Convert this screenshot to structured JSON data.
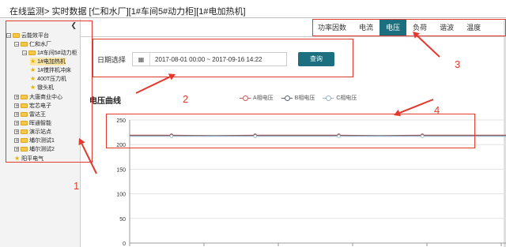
{
  "breadcrumb": "在线监测> 实时数据 [仁和水厂][1#车间5#动力柜][1#电加热机]",
  "sidebar": {
    "collapse_glyph": "❮",
    "items": [
      {
        "label": "云能效平台",
        "expander": "⊟",
        "icon": "folder"
      },
      {
        "label": "仁和水厂",
        "expander": "⊟",
        "icon": "folder"
      },
      {
        "label": "1#车间5#动力柜",
        "expander": "⊟",
        "icon": "folder"
      },
      {
        "label": "1#电加热机",
        "expander": "",
        "icon": "star"
      },
      {
        "label": "1#搅拌机冲床",
        "expander": "",
        "icon": "star"
      },
      {
        "label": "400T压力机",
        "expander": "",
        "icon": "star"
      },
      {
        "label": "镦头机",
        "expander": "",
        "icon": "star"
      },
      {
        "label": "大唐商业中心",
        "expander": "⊞",
        "icon": "folder"
      },
      {
        "label": "宏芯电子",
        "expander": "⊞",
        "icon": "folder"
      },
      {
        "label": "雷达王",
        "expander": "⊞",
        "icon": "folder"
      },
      {
        "label": "晖通智能",
        "expander": "⊞",
        "icon": "folder"
      },
      {
        "label": "演示站点",
        "expander": "⊞",
        "icon": "folder"
      },
      {
        "label": "埔尔测试1",
        "expander": "⊞",
        "icon": "folder"
      },
      {
        "label": "埔尔测试2",
        "expander": "⊞",
        "icon": "folder"
      },
      {
        "label": "阳平电气",
        "expander": "",
        "icon": "star"
      }
    ]
  },
  "tabs": [
    {
      "label": "功率因数"
    },
    {
      "label": "电流"
    },
    {
      "label": "电压",
      "active": true
    },
    {
      "label": "负荷"
    },
    {
      "label": "谐波"
    },
    {
      "label": "温度"
    }
  ],
  "filter": {
    "label": "日期选择",
    "calendar_icon": "▦",
    "date_range": "2017-08-01 00:00 ~ 2017-09-16 14:22",
    "query_label": "查询"
  },
  "chart_title": "电压曲线",
  "annotations": {
    "a1": "1",
    "a2": "2",
    "a3": "3",
    "a4": "4"
  },
  "colors": {
    "accent": "#1b6f7e",
    "annotation": "#e23a2f",
    "series_a": "#d9534f",
    "series_b": "#5b6270",
    "series_c": "#9ab3c6"
  },
  "chart_data": {
    "type": "line",
    "title": "电压曲线",
    "ylim": [
      0,
      250
    ],
    "yticks": [
      0,
      50,
      100,
      150,
      200,
      250
    ],
    "grid": true,
    "legend_position": "top",
    "series": [
      {
        "name": "A相电压",
        "values": [
          219,
          219,
          218,
          219,
          219,
          219,
          218,
          219,
          219,
          219
        ]
      },
      {
        "name": "B相电压",
        "values": [
          218,
          218,
          218,
          218,
          218,
          218,
          218,
          218,
          218,
          218
        ]
      },
      {
        "name": "C相电压",
        "values": [
          217,
          217,
          217,
          217,
          217,
          217,
          217,
          217,
          217,
          217
        ]
      }
    ]
  }
}
